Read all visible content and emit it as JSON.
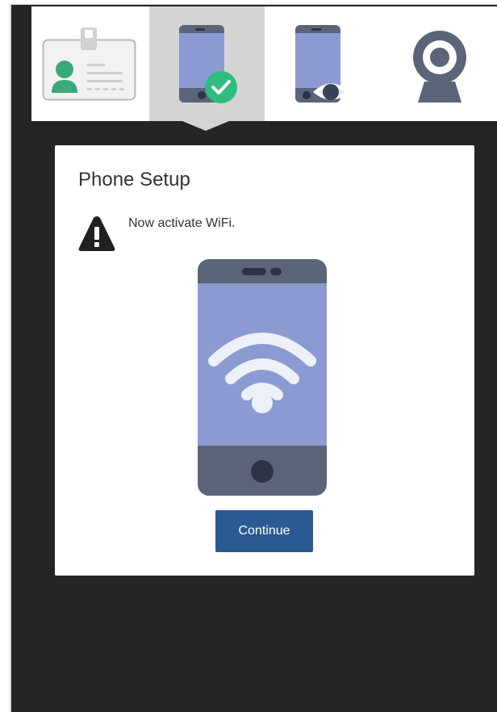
{
  "steps": [
    {
      "icon": "id-card-icon",
      "state": "done"
    },
    {
      "icon": "phone-check-icon",
      "state": "active"
    },
    {
      "icon": "phone-eye-icon",
      "state": "pending"
    },
    {
      "icon": "webcam-icon",
      "state": "pending"
    }
  ],
  "card": {
    "title": "Phone Setup",
    "warning_icon": "warning-triangle-icon",
    "instruction": "Now activate WiFi.",
    "illustration_icon": "phone-wifi-icon",
    "continue_label": "Continue"
  },
  "colors": {
    "background_dark": "#252525",
    "step_active": "#d4d4d4",
    "phone_screen": "#8b9bd2",
    "phone_body": "#5b6478",
    "check_green": "#2ebd7f",
    "id_green": "#3ba87a",
    "button": "#2b5a93"
  }
}
